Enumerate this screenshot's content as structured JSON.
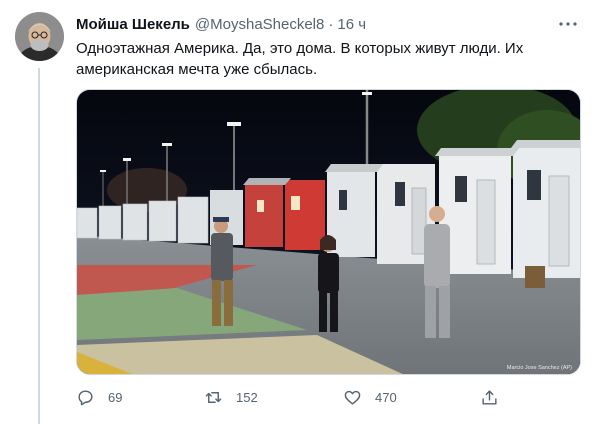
{
  "tweet": {
    "author_name": "Мойша Шекель",
    "handle": "@MoyshaSheckel8",
    "separator": "·",
    "timestamp": "16 ч",
    "text_line1": "Одноэтажная Америка. Да, это дома. В которых живут люди. Их",
    "text_line2": "американская мечта уже сбылась.",
    "photo_credit": "Marcio Jose Sanchez (AP)"
  },
  "actions": {
    "reply_count": "69",
    "retweet_count": "152",
    "like_count": "470"
  },
  "icons": {
    "reply": "reply-icon",
    "retweet": "retweet-icon",
    "like": "like-icon",
    "share": "share-icon",
    "more": "more-icon"
  },
  "colors": {
    "text_primary": "#0f1419",
    "text_secondary": "#536471",
    "divider": "#cfd9de"
  }
}
